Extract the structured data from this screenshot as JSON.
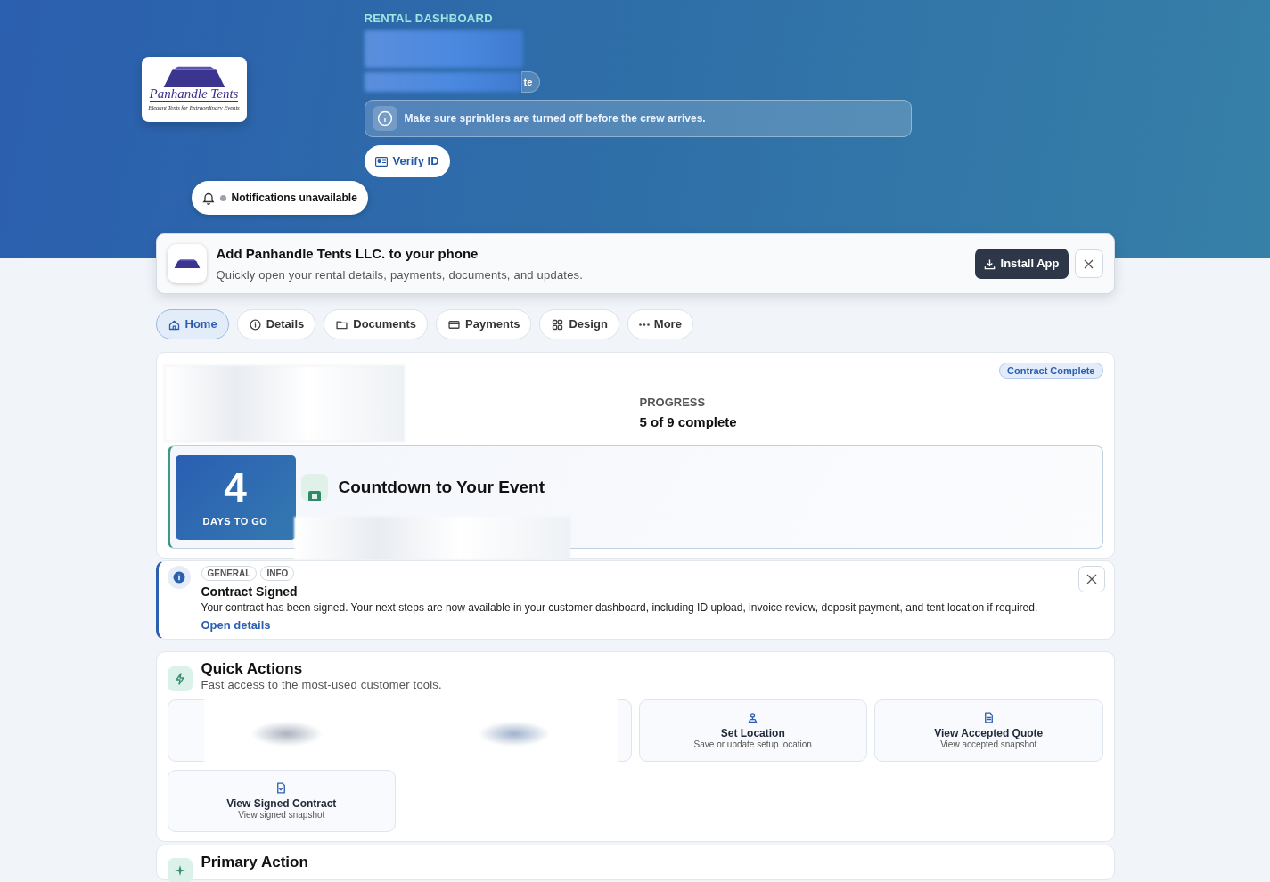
{
  "header": {
    "eyebrow": "RENTAL DASHBOARD",
    "status_badge": "te",
    "notice": "Make sure sprinklers are turned off before the crew arrives.",
    "verify_button": "Verify ID",
    "notifications": "Notifications unavailable",
    "logo": {
      "title": "Panhandle Tents",
      "tagline": "Elegant Tents for Extraordinary Events"
    }
  },
  "install_banner": {
    "title": "Add Panhandle Tents LLC. to your phone",
    "subtitle": "Quickly open your rental details, payments, documents, and updates.",
    "button": "Install App"
  },
  "tabs": [
    {
      "label": "Home",
      "selected": true
    },
    {
      "label": "Details",
      "selected": false
    },
    {
      "label": "Documents",
      "selected": false
    },
    {
      "label": "Payments",
      "selected": false
    },
    {
      "label": "Design",
      "selected": false
    },
    {
      "label": "More",
      "selected": false
    }
  ],
  "progress": {
    "badge": "Contract Complete",
    "label": "PROGRESS",
    "value": "5 of 9 complete"
  },
  "countdown": {
    "number": "4",
    "unit": "DAYS TO GO",
    "title": "Countdown to Your Event"
  },
  "notification": {
    "tags": [
      "GENERAL",
      "INFO"
    ],
    "title": "Contract Signed",
    "body": "Your contract has been signed. Your next steps are now available in your customer dashboard, including ID upload, invoice review, deposit payment, and tent location if required.",
    "link": "Open details"
  },
  "quick_actions": {
    "title": "Quick Actions",
    "subtitle": "Fast access to the most-used customer tools.",
    "items": [
      {
        "title": "Set Location",
        "subtitle": "Save or update setup location"
      },
      {
        "title": "View Accepted Quote",
        "subtitle": "View accepted snapshot"
      },
      {
        "title": "View Signed Contract",
        "subtitle": "View signed snapshot"
      }
    ]
  },
  "primary_action": {
    "title": "Primary Action"
  }
}
